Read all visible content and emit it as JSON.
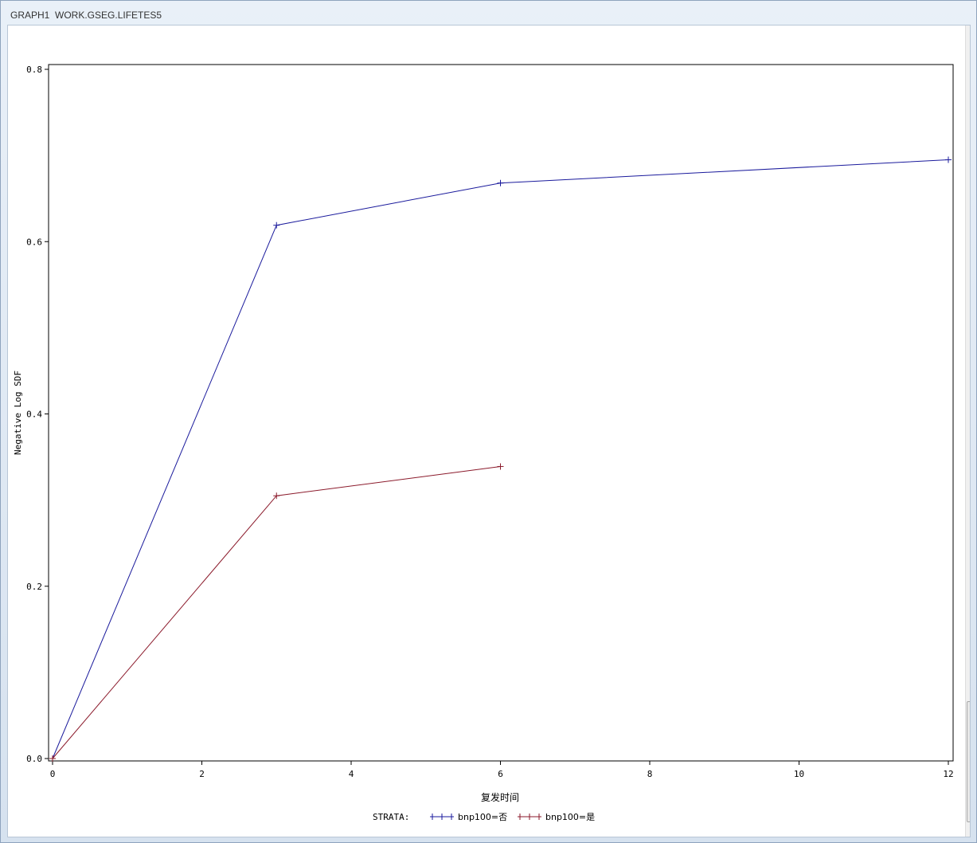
{
  "window": {
    "title": "GRAPH1  WORK.GSEG.LIFETES5"
  },
  "chart_data": {
    "type": "line",
    "title": "",
    "xlabel": "复发时间",
    "ylabel": "Negative Log SDF",
    "xlim": [
      0,
      12
    ],
    "ylim": [
      0,
      0.8
    ],
    "xticks": [
      0,
      2,
      4,
      6,
      8,
      10,
      12
    ],
    "yticks": [
      0.0,
      0.2,
      0.4,
      0.6,
      0.8
    ],
    "ytick_labels": [
      "0.0",
      "0.2",
      "0.4",
      "0.6",
      "0.8"
    ],
    "grid": false,
    "legend_title": "STRATA:",
    "legend_position": "bottom",
    "series": [
      {
        "name": "bnp100=否",
        "color": "#1a1a9c",
        "marker": "plus",
        "x": [
          0,
          3,
          6,
          12
        ],
        "y": [
          0.0,
          0.619,
          0.668,
          0.695
        ]
      },
      {
        "name": "bnp100=是",
        "color": "#8b1a2b",
        "marker": "plus",
        "x": [
          0,
          3,
          6
        ],
        "y": [
          0.0,
          0.305,
          0.339
        ]
      }
    ]
  }
}
